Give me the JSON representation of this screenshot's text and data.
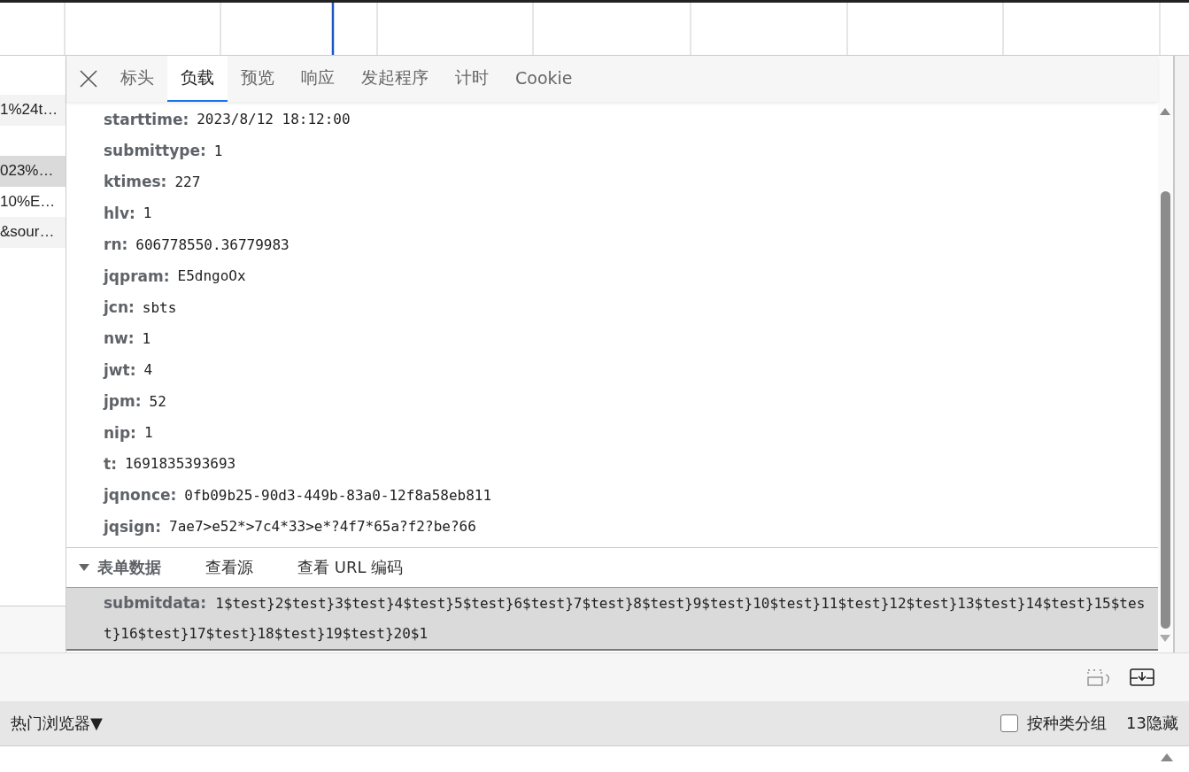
{
  "requests": [
    {
      "kind": "request",
      "text": "1%24t…",
      "selected": false
    },
    {
      "kind": "blank"
    },
    {
      "kind": "request",
      "text": "023%…",
      "selected": true
    },
    {
      "kind": "request",
      "text": "10%E…",
      "selected": false
    },
    {
      "kind": "request",
      "text": "&sour…",
      "selected": false
    }
  ],
  "tabs": [
    {
      "label": "标头",
      "selected": false
    },
    {
      "label": "负载",
      "selected": true
    },
    {
      "label": "预览",
      "selected": false
    },
    {
      "label": "响应",
      "selected": false
    },
    {
      "label": "发起程序",
      "selected": false
    },
    {
      "label": "计时",
      "selected": false
    },
    {
      "label": "Cookie",
      "selected": false
    }
  ],
  "params": [
    {
      "key": "starttime:",
      "value": "2023/8/12 18:12:00"
    },
    {
      "key": "submittype:",
      "value": "1"
    },
    {
      "key": "ktimes:",
      "value": "227"
    },
    {
      "key": "hlv:",
      "value": "1"
    },
    {
      "key": "rn:",
      "value": "606778550.36779983"
    },
    {
      "key": "jqpram:",
      "value": "E5dngoOx"
    },
    {
      "key": "jcn:",
      "value": "sbts"
    },
    {
      "key": "nw:",
      "value": "1"
    },
    {
      "key": "jwt:",
      "value": "4"
    },
    {
      "key": "jpm:",
      "value": "52"
    },
    {
      "key": "nip:",
      "value": "1"
    },
    {
      "key": "t:",
      "value": "1691835393693"
    },
    {
      "key": "jqnonce:",
      "value": "0fb09b25-90d3-449b-83a0-12f8a58eb811"
    },
    {
      "key": "jqsign:",
      "value": "7ae7>e52*>7c4*33>e*?4f7*65a?f2?be?66"
    }
  ],
  "form_data": {
    "title": "表单数据",
    "expanded": true,
    "links": [
      "查看源",
      "查看 URL 编码"
    ],
    "rows": [
      {
        "key": "submitdata:",
        "value": "1$test}2$test}3$test}4$test}5$test}6$test}7$test}8$test}9$test}10$test}11$test}12$test}13$test}14$test}15$test}16$test}17$test}18$test}19$test}20$1"
      }
    ]
  },
  "status_bar": {
    "filter": "热门浏览器",
    "dropdown_glyph": "▼",
    "group_checkbox": {
      "label": "按种类分组",
      "checked": false
    },
    "hidden_count": "13隐藏"
  }
}
